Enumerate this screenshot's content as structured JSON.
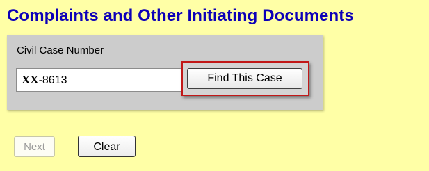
{
  "header": {
    "title": "Complaints and Other Initiating Documents"
  },
  "search": {
    "label": "Civil Case Number",
    "case_number_prefix": "XX",
    "case_number_suffix": "-8613",
    "find_button_label": "Find This Case"
  },
  "actions": {
    "next_label": "Next",
    "next_enabled": false,
    "clear_label": "Clear"
  },
  "colors": {
    "page_background": "#ffffa6",
    "title": "#0d00b8",
    "panel_background": "#cccccc",
    "highlight_border": "#c21818"
  }
}
